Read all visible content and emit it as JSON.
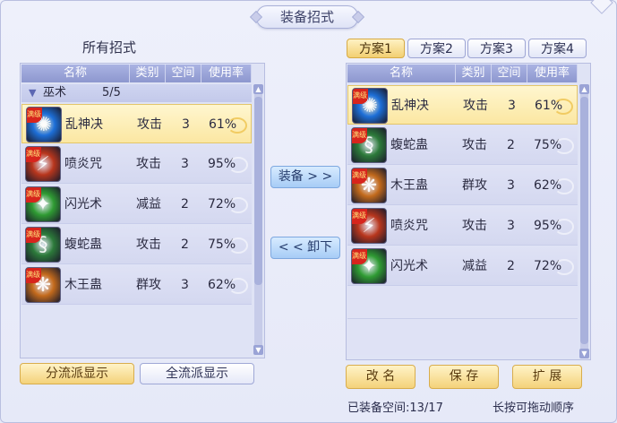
{
  "window": {
    "title": "装备招式"
  },
  "left": {
    "section_title": "所有招式",
    "columns": [
      "名称",
      "类别",
      "空间",
      "使用率"
    ],
    "group": {
      "name": "巫术",
      "count": "5/5"
    },
    "rows": [
      {
        "name": "乱神决",
        "category": "攻击",
        "space": "3",
        "rate": "61%",
        "icon": "ice-burst-icon",
        "color": "#1d6fd8",
        "selected": true
      },
      {
        "name": "喷炎咒",
        "category": "攻击",
        "space": "3",
        "rate": "95%",
        "icon": "flame-rune-icon",
        "color": "#b8361d"
      },
      {
        "name": "闪光术",
        "category": "减益",
        "space": "2",
        "rate": "72%",
        "icon": "green-flash-icon",
        "color": "#2f9b33"
      },
      {
        "name": "蝮蛇蛊",
        "category": "攻击",
        "space": "2",
        "rate": "75%",
        "icon": "serpent-icon",
        "color": "#2c7a3a"
      },
      {
        "name": "木王蛊",
        "category": "群攻",
        "space": "3",
        "rate": "62%",
        "icon": "wood-king-icon",
        "color": "#c36a1c"
      }
    ],
    "buttons": {
      "by_school": "分流派显示",
      "all_school": "全流派显示"
    }
  },
  "middle": {
    "equip": "装备 > >",
    "unequip": "< < 卸下"
  },
  "right": {
    "tabs": [
      "方案1",
      "方案2",
      "方案3",
      "方案4"
    ],
    "active_tab": 0,
    "columns": [
      "名称",
      "类别",
      "空间",
      "使用率"
    ],
    "rows": [
      {
        "name": "乱神决",
        "category": "攻击",
        "space": "3",
        "rate": "61%",
        "icon": "ice-burst-icon",
        "color": "#1d6fd8",
        "selected": true
      },
      {
        "name": "蝮蛇蛊",
        "category": "攻击",
        "space": "2",
        "rate": "75%",
        "icon": "serpent-icon",
        "color": "#2c7a3a"
      },
      {
        "name": "木王蛊",
        "category": "群攻",
        "space": "3",
        "rate": "62%",
        "icon": "wood-king-icon",
        "color": "#c36a1c"
      },
      {
        "name": "喷炎咒",
        "category": "攻击",
        "space": "3",
        "rate": "95%",
        "icon": "flame-rune-icon",
        "color": "#b8361d"
      },
      {
        "name": "闪光术",
        "category": "减益",
        "space": "2",
        "rate": "72%",
        "icon": "green-flash-icon",
        "color": "#2f9b33"
      }
    ],
    "buttons": {
      "rename": "改 名",
      "save": "保 存",
      "expand": "扩 展"
    },
    "footer_space": "已装备空间:13/17",
    "footer_hint": "长按可拖动顺序"
  },
  "badge_text": "满级"
}
